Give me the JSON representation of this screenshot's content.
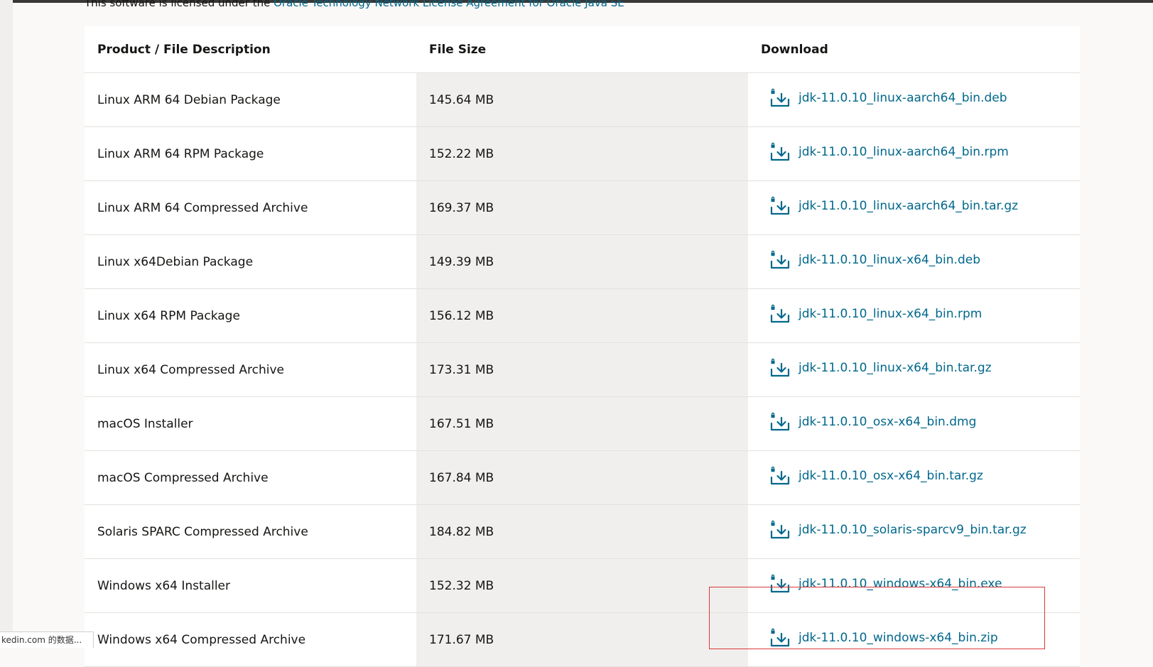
{
  "license": {
    "prefix": "This software is licensed under the",
    "link_text": "Oracle Technology Network License Agreement for Oracle Java SE"
  },
  "table": {
    "headers": [
      "Product / File Description",
      "File Size",
      "Download"
    ],
    "rows": [
      {
        "description": "Linux ARM 64 Debian Package",
        "size": "145.64 MB",
        "file": "jdk-11.0.10_linux-aarch64_bin.deb"
      },
      {
        "description": "Linux ARM 64 RPM Package",
        "size": "152.22 MB",
        "file": "jdk-11.0.10_linux-aarch64_bin.rpm"
      },
      {
        "description": "Linux ARM 64 Compressed Archive",
        "size": "169.37 MB",
        "file": "jdk-11.0.10_linux-aarch64_bin.tar.gz"
      },
      {
        "description": "Linux x64Debian Package",
        "size": "149.39 MB",
        "file": "jdk-11.0.10_linux-x64_bin.deb"
      },
      {
        "description": "Linux x64 RPM Package",
        "size": "156.12 MB",
        "file": "jdk-11.0.10_linux-x64_bin.rpm"
      },
      {
        "description": "Linux x64 Compressed Archive",
        "size": "173.31 MB",
        "file": "jdk-11.0.10_linux-x64_bin.tar.gz"
      },
      {
        "description": "macOS Installer",
        "size": "167.51 MB",
        "file": "jdk-11.0.10_osx-x64_bin.dmg"
      },
      {
        "description": "macOS Compressed Archive",
        "size": "167.84 MB",
        "file": "jdk-11.0.10_osx-x64_bin.tar.gz"
      },
      {
        "description": "Solaris SPARC Compressed Archive",
        "size": "184.82 MB",
        "file": "jdk-11.0.10_solaris-sparcv9_bin.tar.gz"
      },
      {
        "description": "Windows x64 Installer",
        "size": "152.32 MB",
        "file": "jdk-11.0.10_windows-x64_bin.exe"
      },
      {
        "description": "Windows x64 Compressed Archive",
        "size": "171.67 MB",
        "file": "jdk-11.0.10_windows-x64_bin.zip"
      }
    ]
  },
  "status_bar": {
    "text": "kedin.com 的数据..."
  },
  "colors": {
    "link": "#00688c",
    "text": "#161513",
    "size_column_bg": "#f1efed",
    "highlight": "#d9383a"
  },
  "icons": {
    "download": "download-lock-icon"
  }
}
